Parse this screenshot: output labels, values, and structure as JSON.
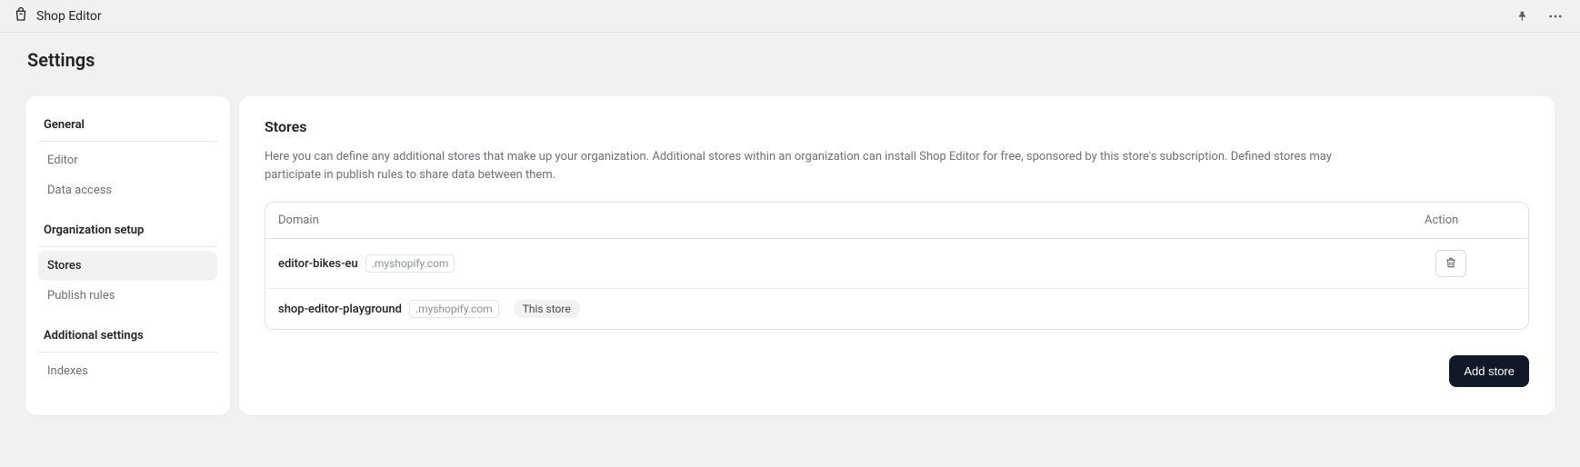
{
  "topbar": {
    "app_name": "Shop Editor"
  },
  "page": {
    "title": "Settings"
  },
  "sidebar": {
    "groups": [
      {
        "title": "General",
        "items": [
          {
            "label": "Editor",
            "active": false
          },
          {
            "label": "Data access",
            "active": false
          }
        ]
      },
      {
        "title": "Organization setup",
        "items": [
          {
            "label": "Stores",
            "active": true
          },
          {
            "label": "Publish rules",
            "active": false
          }
        ]
      },
      {
        "title": "Additional settings",
        "items": [
          {
            "label": "Indexes",
            "active": false
          }
        ]
      }
    ]
  },
  "main": {
    "title": "Stores",
    "description": "Here you can define any additional stores that make up your organization. Additional stores within an organization can install Shop Editor for free, sponsored by this store's subscription. Defined stores may participate in publish rules to share data between them.",
    "columns": {
      "domain": "Domain",
      "action": "Action"
    },
    "domain_suffix": ".myshopify.com",
    "this_store_badge": "This store",
    "rows": [
      {
        "domain": "editor-bikes-eu",
        "this_store": false,
        "deletable": true
      },
      {
        "domain": "shop-editor-playground",
        "this_store": true,
        "deletable": false
      }
    ],
    "add_button": "Add store"
  }
}
